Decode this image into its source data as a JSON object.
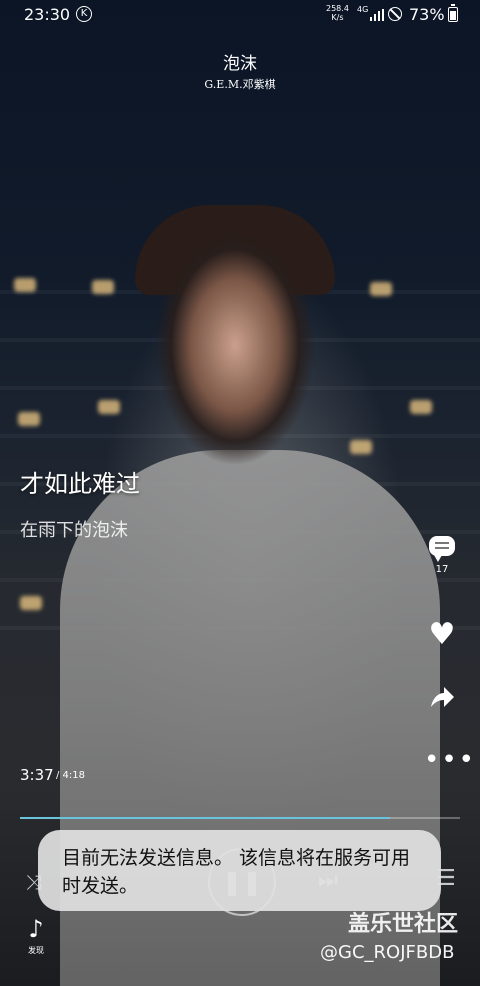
{
  "status_bar": {
    "time": "23:30",
    "k_icon": "K",
    "speed_value": "258.4",
    "speed_unit": "K/s",
    "network": "4G",
    "battery": "73%"
  },
  "song": {
    "title": "泡沫",
    "artist": "G.E.M.邓紫棋"
  },
  "lyrics": {
    "current": "才如此难过",
    "next": "在雨下的泡沫"
  },
  "side_actions": {
    "comment_count": "17",
    "heart_glyph": "♥",
    "more_glyph": "•••",
    "icons": [
      "comment-icon",
      "heart-icon",
      "share-icon",
      "more-icon"
    ]
  },
  "playback": {
    "current_time": "3:37",
    "total_time": "/ 4:18",
    "progress_fraction": 0.84
  },
  "controls": {
    "shuffle_glyph": "⤨",
    "play_glyph": "❚❚",
    "next_glyph": "⏭",
    "playlist_glyph": "☰"
  },
  "toast": {
    "message": "目前无法发送信息。 该信息将在服务可用时发送。"
  },
  "bottom_nav": {
    "discover_icon_glyph": "♪",
    "discover_label": "发现"
  },
  "watermark": {
    "brand": "盖乐世社区",
    "user": "@GC_ROJFBDB"
  },
  "colors": {
    "progress_fill": "#6ac3d9",
    "toast_bg": "#e1e1e1"
  }
}
